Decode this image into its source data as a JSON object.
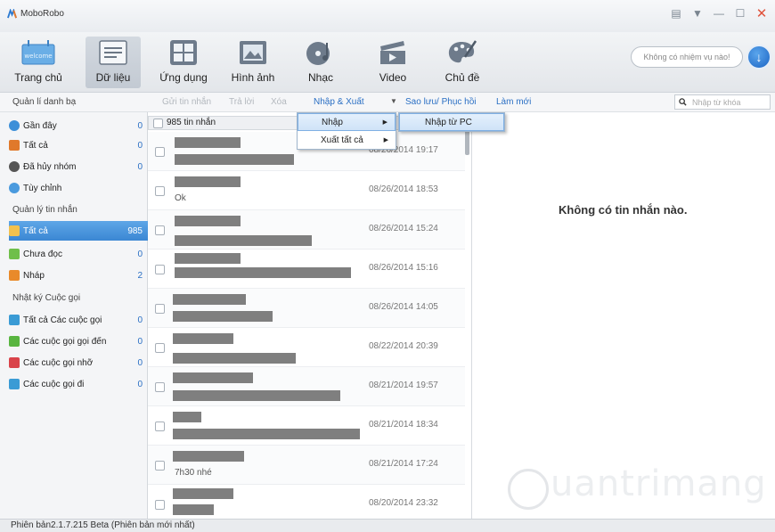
{
  "window": {
    "title": "MoboRobo",
    "controls": [
      "menu-icon",
      "dropdown-icon",
      "minimize-icon",
      "maximize-icon",
      "close-icon"
    ]
  },
  "toolbar": {
    "items": [
      {
        "label": "Trang chủ",
        "icon": "welcome-icon",
        "icon_text": "welcome"
      },
      {
        "label": "Dữ liệu",
        "icon": "data-icon",
        "active": true
      },
      {
        "label": "Ứng dụng",
        "icon": "apps-icon"
      },
      {
        "label": "Hình ảnh",
        "icon": "image-icon"
      },
      {
        "label": "Nhạc",
        "icon": "music-icon"
      },
      {
        "label": "Video",
        "icon": "video-icon"
      },
      {
        "label": "Chủ đề",
        "icon": "theme-icon"
      }
    ],
    "task_status": "Không có nhiệm vụ nào!",
    "download_icon": "download-icon"
  },
  "actionbar": {
    "section_title": "Quản lí danh bạ",
    "actions": [
      {
        "label": "Gửi tin nhắn",
        "enabled": false
      },
      {
        "label": "Trả lời",
        "enabled": false
      },
      {
        "label": "Xóa",
        "enabled": false
      },
      {
        "label": "Nhập & Xuất",
        "enabled": true
      },
      {
        "label": "Sao lưu/ Phục hồi",
        "enabled": true
      },
      {
        "label": "Làm mới",
        "enabled": true
      }
    ],
    "search_placeholder": "Nhập từ khóa"
  },
  "sidebar": {
    "contacts_items": [
      {
        "label": "Gần đây",
        "count": "0",
        "color": "#3d8fd8"
      },
      {
        "label": "Tất cả",
        "count": "0",
        "color": "#e0792b"
      },
      {
        "label": "Đã hủy nhóm",
        "count": "0",
        "color": "#555555"
      },
      {
        "label": "Tùy chỉnh",
        "count": "",
        "color": "#4a9ade"
      }
    ],
    "messages_title": "Quản lý tin nhắn",
    "messages_items": [
      {
        "label": "Tất cả",
        "count": "985",
        "color": "#f2c14e",
        "selected": true
      },
      {
        "label": "Chưa đọc",
        "count": "0",
        "color": "#6fbf4a"
      },
      {
        "label": "Nháp",
        "count": "2",
        "color": "#e98a2a"
      }
    ],
    "calls_title": "Nhật ký Cuộc gọi",
    "calls_items": [
      {
        "label": "Tất cả Các cuộc gọi",
        "count": "0",
        "color": "#3a9bd5"
      },
      {
        "label": "Các cuộc gọi gọi đến",
        "count": "0",
        "color": "#59b540"
      },
      {
        "label": "Các cuộc gọi nhỡ",
        "count": "0",
        "color": "#d9434a"
      },
      {
        "label": "Các cuộc gọi đi",
        "count": "0",
        "color": "#3a9bd5"
      }
    ]
  },
  "message_list": {
    "header": "985 tin nhắn",
    "rows": [
      {
        "preview": "",
        "date": "08/26/2014 19:17"
      },
      {
        "preview": "Ok",
        "date": "08/26/2014 18:53"
      },
      {
        "preview": "",
        "date": "08/26/2014 15:24"
      },
      {
        "preview": "",
        "date": "08/26/2014 15:16"
      },
      {
        "preview": "",
        "date": "08/26/2014 14:05"
      },
      {
        "preview": "",
        "date": "08/22/2014 20:39"
      },
      {
        "preview": "",
        "date": "08/21/2014 19:57"
      },
      {
        "preview": "",
        "date": "08/21/2014 18:34"
      },
      {
        "preview": "7h30 nhé",
        "date": "08/21/2014 17:24"
      },
      {
        "preview": "",
        "date": "08/20/2014 23:32"
      }
    ]
  },
  "detail": {
    "empty_text": "Không có tin nhắn nào."
  },
  "menu": {
    "items": [
      {
        "label": "Nhập",
        "has_sub": true,
        "highlight": true
      },
      {
        "label": "Xuất tất cả",
        "has_sub": true,
        "highlight": false
      }
    ],
    "submenu_items": [
      {
        "label": "Nhập từ PC"
      }
    ]
  },
  "watermark": "uantrimang",
  "status": {
    "version": "Phiên bản2.1.7.215 Beta  (Phiên bản mới nhất)"
  }
}
